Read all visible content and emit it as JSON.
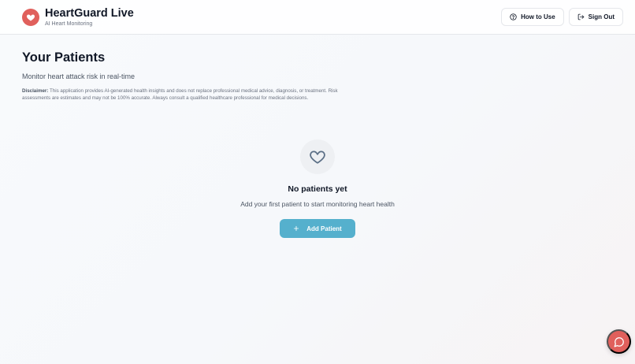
{
  "header": {
    "app_title": "HeartGuard Live",
    "app_subtitle": "AI Heart Monitoring",
    "how_to_use_label": "How to Use",
    "sign_out_label": "Sign Out"
  },
  "main": {
    "title": "Your Patients",
    "subtitle": "Monitor heart attack risk in real-time",
    "disclaimer_label": "Disclaimer:",
    "disclaimer_text": "This application provides AI-generated health insights and does not replace professional medical advice, diagnosis, or treatment. Risk assessments are estimates and may not be 100% accurate. Always consult a qualified healthcare professional for medical decisions."
  },
  "empty_state": {
    "title": "No patients yet",
    "message": "Add your first patient to start monitoring heart health",
    "add_button_label": "Add Patient"
  },
  "icons": {
    "logo": "heart-icon",
    "how_to_use": "help-circle-icon",
    "sign_out": "log-out-icon",
    "empty": "heart-outline-icon",
    "add": "plus-icon",
    "chat": "chat-bubble-icon"
  },
  "colors": {
    "brand_red": "#e0605c",
    "primary_button": "#55b0cd"
  }
}
